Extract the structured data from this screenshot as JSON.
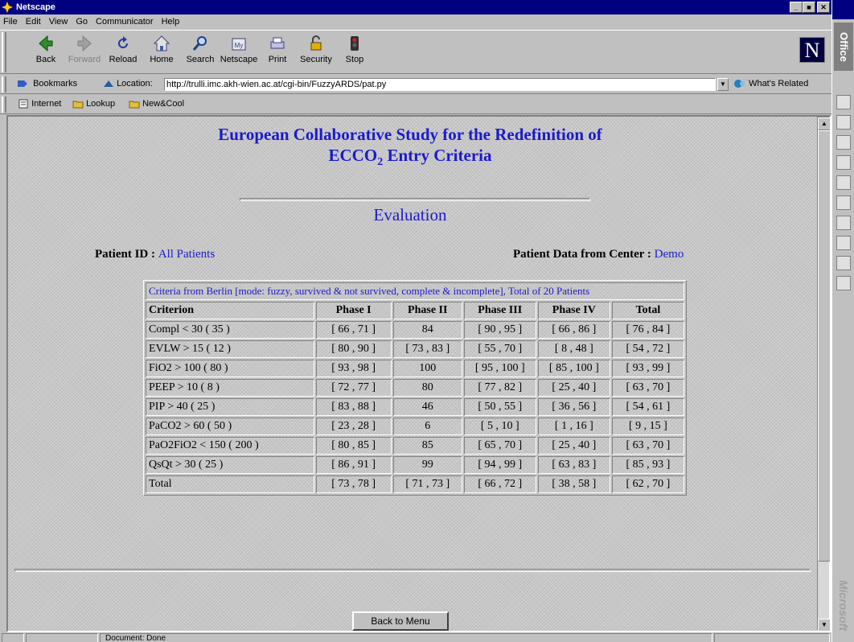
{
  "window": {
    "title": "Netscape"
  },
  "menu": [
    "File",
    "Edit",
    "View",
    "Go",
    "Communicator",
    "Help"
  ],
  "toolbar": [
    {
      "label": "Back",
      "icon": "back-arrow-icon",
      "enabled": true
    },
    {
      "label": "Forward",
      "icon": "forward-arrow-icon",
      "enabled": false
    },
    {
      "label": "Reload",
      "icon": "reload-icon",
      "enabled": true
    },
    {
      "label": "Home",
      "icon": "home-icon",
      "enabled": true
    },
    {
      "label": "Search",
      "icon": "search-icon",
      "enabled": true
    },
    {
      "label": "Netscape",
      "icon": "netscape-icon",
      "enabled": true
    },
    {
      "label": "Print",
      "icon": "print-icon",
      "enabled": true
    },
    {
      "label": "Security",
      "icon": "lock-icon",
      "enabled": true
    },
    {
      "label": "Stop",
      "icon": "stop-icon",
      "enabled": true
    }
  ],
  "location": {
    "bookmarks_label": "Bookmarks",
    "location_label": "Location:",
    "url": "http://trulli.imc.akh-wien.ac.at/cgi-bin/FuzzyARDS/pat.py",
    "whats_related": "What's Related"
  },
  "personal": [
    "Internet",
    "Lookup",
    "New&Cool"
  ],
  "page": {
    "title_line1": "European Collaborative Study for the Redefinition of",
    "title_line2_pre": "ECCO",
    "title_line2_sub": "2",
    "title_line2_post": " Entry Criteria",
    "subtitle": "Evaluation",
    "patient_id_label": "Patient ID :",
    "patient_id_value": "All Patients",
    "center_label": "Patient Data from Center :",
    "center_value": "Demo",
    "back_button": "Back to Menu"
  },
  "table": {
    "caption": "Criteria from Berlin [mode: fuzzy, survived & not survived, complete & incomplete], Total of 20 Patients",
    "headers": [
      "Criterion",
      "Phase I",
      "Phase II",
      "Phase III",
      "Phase IV",
      "Total"
    ],
    "rows": [
      [
        "Compl < 30 ( 35 )",
        "[ 66 , 71 ]",
        "84",
        "[ 90 , 95 ]",
        "[ 66 , 86 ]",
        "[ 76 , 84 ]"
      ],
      [
        "EVLW > 15 ( 12 )",
        "[ 80 , 90 ]",
        "[ 73 , 83 ]",
        "[ 55 , 70 ]",
        "[ 8 , 48 ]",
        "[ 54 , 72 ]"
      ],
      [
        "FiO2 > 100 ( 80 )",
        "[ 93 , 98 ]",
        "100",
        "[ 95 , 100 ]",
        "[ 85 , 100 ]",
        "[ 93 , 99 ]"
      ],
      [
        "PEEP > 10 ( 8 )",
        "[ 72 , 77 ]",
        "80",
        "[ 77 , 82 ]",
        "[ 25 , 40 ]",
        "[ 63 , 70 ]"
      ],
      [
        "PIP > 40 ( 25 )",
        "[ 83 , 88 ]",
        "46",
        "[ 50 , 55 ]",
        "[ 36 , 56 ]",
        "[ 54 , 61 ]"
      ],
      [
        "PaCO2 > 60 ( 50 )",
        "[ 23 , 28 ]",
        "6",
        "[ 5 , 10 ]",
        "[ 1 , 16 ]",
        "[ 9 , 15 ]"
      ],
      [
        "PaO2FiO2 < 150 ( 200 )",
        "[ 80 , 85 ]",
        "85",
        "[ 65 , 70 ]",
        "[ 25 , 40 ]",
        "[ 63 , 70 ]"
      ],
      [
        "QsQt > 30 ( 25 )",
        "[ 86 , 91 ]",
        "99",
        "[ 94 , 99 ]",
        "[ 63 , 83 ]",
        "[ 85 , 93 ]"
      ],
      [
        "Total",
        "[ 73 , 78 ]",
        "[ 71 , 73 ]",
        "[ 66 , 72 ]",
        "[ 38 , 58 ]",
        "[ 62 , 70 ]"
      ]
    ]
  },
  "status": {
    "text": "Document: Done"
  },
  "office": {
    "label": "Office",
    "brand": "Microsoft"
  },
  "colors": {
    "title_bar": "#000080",
    "link_blue": "#1a1acc",
    "chrome": "#c0c0c0"
  }
}
